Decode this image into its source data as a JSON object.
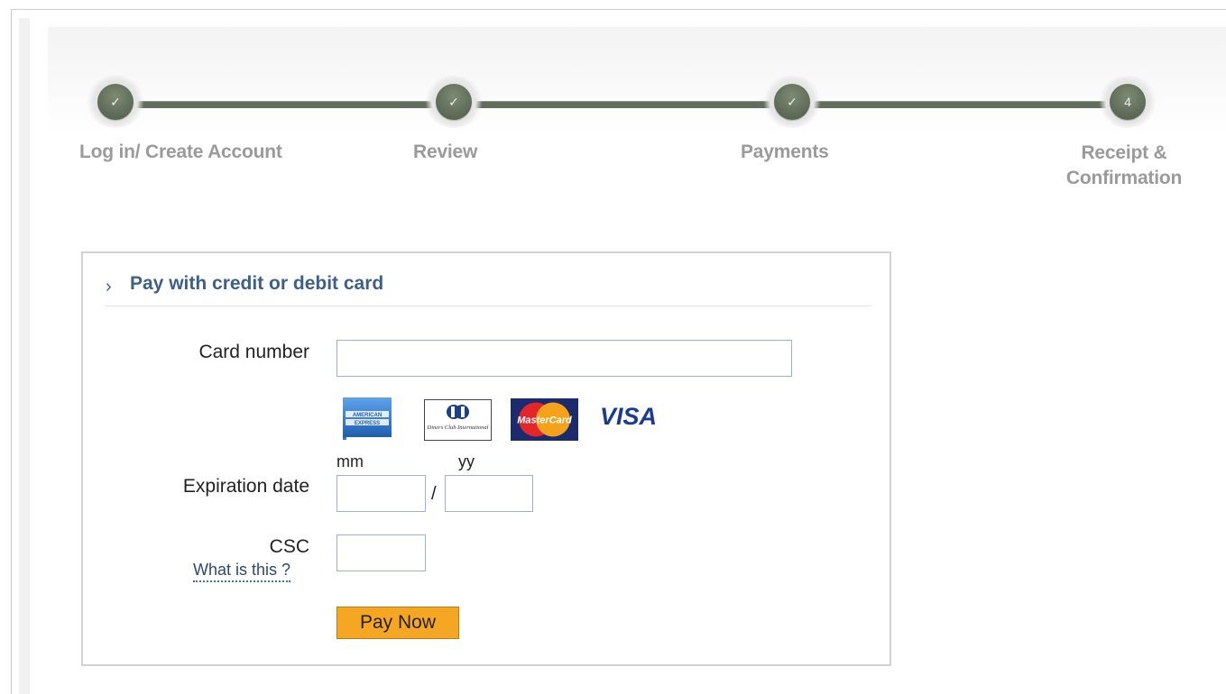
{
  "progress": {
    "steps": [
      {
        "label": "Log in/ Create Account",
        "marker": "✓",
        "state": "done"
      },
      {
        "label": "Review",
        "marker": "✓",
        "state": "done"
      },
      {
        "label": "Payments",
        "marker": "✓",
        "state": "done"
      },
      {
        "label_line1": "Receipt &",
        "label_line2": "Confirmation",
        "marker": "4",
        "state": "pending"
      }
    ]
  },
  "payment": {
    "chevron": "›",
    "title": "Pay with credit or debit card",
    "card_number_label": "Card number",
    "card_number_value": "",
    "card_logos": [
      {
        "name": "american-express-logo",
        "text_line1": "AMERICAN",
        "text_line2": "EXPRESS"
      },
      {
        "name": "diners-club-logo",
        "text": "Diners Club International"
      },
      {
        "name": "mastercard-logo",
        "text": "MasterCard"
      },
      {
        "name": "visa-logo",
        "text": "VISA"
      }
    ],
    "mm_label": "mm",
    "yy_label": "yy",
    "expiration_label": "Expiration date",
    "expiry_separator": "/",
    "month_value": "",
    "year_value": "",
    "csc_label": "CSC",
    "csc_help_link": "What is this ?",
    "csc_value": "",
    "pay_button": "Pay Now"
  },
  "colors": {
    "progress_green": "#606d58",
    "header_blue": "#3e5f86",
    "button_orange": "#f5a623"
  }
}
